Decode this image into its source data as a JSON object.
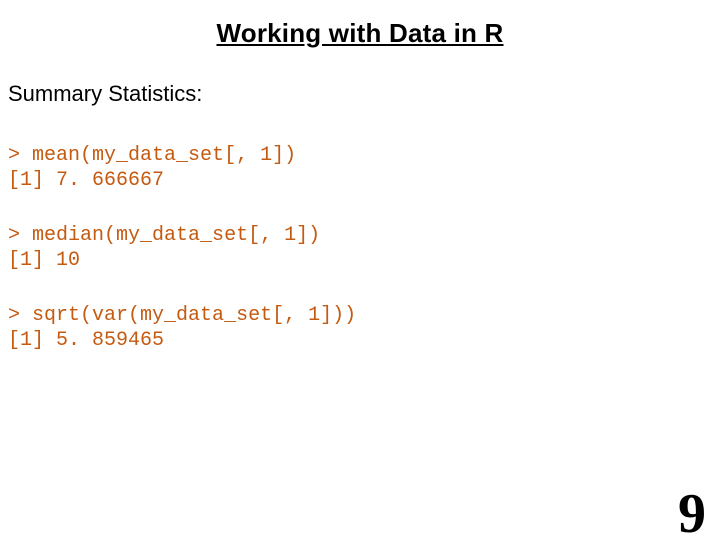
{
  "title": "Working with Data in R",
  "heading": "Summary Statistics:",
  "blocks": [
    {
      "prompt": ">",
      "command": "mean(my_data_set[, 1])",
      "output": "[1] 7. 666667"
    },
    {
      "prompt": ">",
      "command": "median(my_data_set[, 1])",
      "output": "[1] 10"
    },
    {
      "prompt": ">",
      "command": "sqrt(var(my_data_set[, 1]))",
      "output": "[1] 5. 859465"
    }
  ],
  "page_number": "9"
}
